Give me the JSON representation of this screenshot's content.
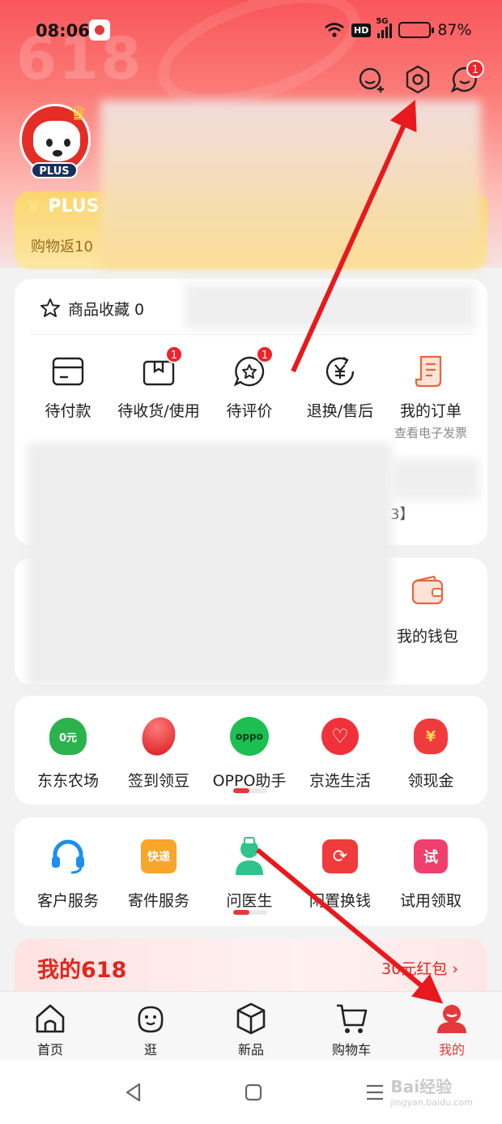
{
  "status_bar": {
    "time": "08:06",
    "network": "5G",
    "hd_label": "HD",
    "battery_pct": 87,
    "battery_text": "87%"
  },
  "header": {
    "bg_text": "618",
    "plus_badge": "PLUS",
    "notification_badge": "1"
  },
  "plus_card": {
    "title": "PLUS",
    "subtitle": "购物返10"
  },
  "favorites": {
    "label": "商品收藏 0"
  },
  "orders": [
    {
      "label": "待付款",
      "badge": "",
      "icon": "wallet-card-icon"
    },
    {
      "label": "待收货/使用",
      "badge": "1",
      "icon": "package-icon"
    },
    {
      "label": "待评价",
      "badge": "1",
      "icon": "review-star-icon"
    },
    {
      "label": "退换/售后",
      "badge": "",
      "icon": "refund-yen-icon"
    },
    {
      "label": "我的订单",
      "badge": "",
      "icon": "order-receipt-icon",
      "note": "查看电子发票"
    }
  ],
  "blurred_suffix": "3】",
  "wallet": {
    "label": "我的钱包"
  },
  "services1": [
    {
      "label": "东东农场",
      "icon": "farm-tree-icon",
      "icon_text": "0元"
    },
    {
      "label": "签到领豆",
      "icon": "bean-icon",
      "icon_text": ""
    },
    {
      "label": "OPPO助手",
      "icon": "oppo-icon",
      "icon_text": "oppo"
    },
    {
      "label": "京选生活",
      "icon": "heart-life-icon",
      "icon_text": ""
    },
    {
      "label": "领现金",
      "icon": "money-bag-icon",
      "icon_text": "¥"
    }
  ],
  "services2": [
    {
      "label": "客户服务",
      "icon": "headset-icon",
      "icon_text": ""
    },
    {
      "label": "寄件服务",
      "icon": "express-box-icon",
      "icon_text": "快递"
    },
    {
      "label": "问医生",
      "icon": "doctor-icon",
      "icon_text": ""
    },
    {
      "label": "闲置换钱",
      "icon": "recycle-bag-icon",
      "icon_text": ""
    },
    {
      "label": "试用领取",
      "icon": "trial-icon",
      "icon_text": "试"
    }
  ],
  "my618": {
    "title": "我的618",
    "right_label": "30元红包"
  },
  "tabbar": [
    {
      "label": "首页",
      "icon": "home-icon",
      "active": false
    },
    {
      "label": "逛",
      "icon": "browse-icon",
      "active": false
    },
    {
      "label": "新品",
      "icon": "new-product-cube-icon",
      "active": false
    },
    {
      "label": "购物车",
      "icon": "cart-icon",
      "active": false
    },
    {
      "label": "我的",
      "icon": "profile-icon",
      "active": true
    }
  ],
  "watermark": {
    "main": "Bai经验",
    "sub": "jingyan.baidu.com"
  },
  "colors": {
    "brand_red": "#e4393c",
    "plus_gold": "#fbd56e",
    "arrow_red": "#e8191c"
  }
}
